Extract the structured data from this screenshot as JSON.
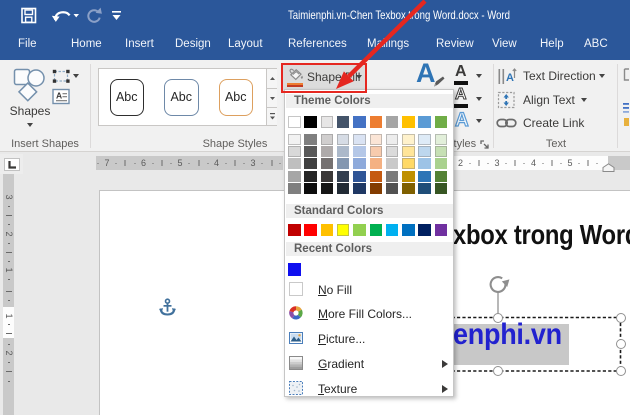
{
  "window": {
    "title": "Taimienphi.vn-Chen Texbox trong Word.docx  -  Word"
  },
  "tabs": [
    "File",
    "Home",
    "Insert",
    "Design",
    "Layout",
    "References",
    "Mailings",
    "Review",
    "View",
    "Help",
    "ABC"
  ],
  "ribbon": {
    "insert_shapes": {
      "label": "Insert Shapes",
      "shapes_button": "Shapes"
    },
    "shape_styles": {
      "label": "Shape Styles",
      "gallery_items": [
        "Abc",
        "Abc",
        "Abc"
      ],
      "gallery_outline_colors": [
        "#2E2E2E",
        "#6E89A8",
        "#DDA05F"
      ],
      "shape_fill_button": "Shape Fill"
    },
    "wordart": {
      "label": "WordArt Styles",
      "quick_styles_letter": "A",
      "text_fill_letter": "A",
      "text_outline_letter": "A",
      "text_effects_letter": "A"
    },
    "text_group": {
      "label": "Text",
      "text_direction": "Text Direction",
      "align_text": "Align Text",
      "create_link": "Create Link"
    }
  },
  "ruler": {
    "h_left_numbers": [
      "7",
      "6",
      "5",
      "4",
      "3"
    ],
    "h_right_numbers": [
      "2",
      "3",
      "4",
      "5"
    ],
    "v_numbers": [
      "3",
      "2",
      "1",
      "1",
      "2"
    ]
  },
  "document": {
    "heading_visible_text": "xbox trong Word",
    "textbox_visible_text": "enphi.vn",
    "textbox_text_color": "#2222CF",
    "selection_highlight_color": "#C8C8C8"
  },
  "menu": {
    "theme_section_label": "Theme Colors",
    "standard_section_label": "Standard Colors",
    "recent_section_label": "Recent Colors",
    "theme_colors": [
      "#FFFFFF",
      "#000000",
      "#E7E6E6",
      "#44546A",
      "#4472C4",
      "#ED7D31",
      "#A5A5A5",
      "#FFC000",
      "#5B9BD5",
      "#70AD47"
    ],
    "theme_tints": [
      [
        "#F2F2F2",
        "#D9D9D9",
        "#BFBFBF",
        "#A6A6A6",
        "#7F7F7F"
      ],
      [
        "#7F7F7F",
        "#595959",
        "#404040",
        "#262626",
        "#0D0D0D"
      ],
      [
        "#D0CECE",
        "#AEAAAA",
        "#757171",
        "#3B3838",
        "#161616"
      ],
      [
        "#D6DCE5",
        "#ACB9CA",
        "#8497B0",
        "#333F50",
        "#222B35"
      ],
      [
        "#DAE3F3",
        "#B4C7E7",
        "#8EAADB",
        "#2F5597",
        "#1F3864"
      ],
      [
        "#FBE5D6",
        "#F8CBAD",
        "#F4B183",
        "#C55A11",
        "#833C00"
      ],
      [
        "#EDEDED",
        "#DBDBDB",
        "#C9C9C9",
        "#7B7B7B",
        "#525252"
      ],
      [
        "#FFF2CC",
        "#FFE599",
        "#FFD966",
        "#BF9000",
        "#7F6000"
      ],
      [
        "#DEEBF7",
        "#BDD7EE",
        "#9DC3E6",
        "#2E75B6",
        "#1F4E79"
      ],
      [
        "#E2EFDA",
        "#C6E0B4",
        "#A9D18E",
        "#548235",
        "#375623"
      ]
    ],
    "standard_colors": [
      "#C00000",
      "#FF0000",
      "#FFC000",
      "#FFFF00",
      "#92D050",
      "#00B050",
      "#00B0F0",
      "#0070C0",
      "#002060",
      "#7030A0"
    ],
    "recent_colors": [
      "#0F0FEF"
    ],
    "items": [
      {
        "icon": "no-fill-icon",
        "label": "No Fill",
        "submenu": false
      },
      {
        "icon": "color-wheel-icon",
        "label": "More Fill Colors...",
        "submenu": false
      },
      {
        "icon": "picture-icon",
        "label": "Picture...",
        "submenu": false
      },
      {
        "icon": "gradient-icon",
        "label": "Gradient",
        "submenu": true
      },
      {
        "icon": "texture-icon",
        "label": "Texture",
        "submenu": true
      }
    ]
  },
  "annotations": {
    "highlight_color": "#E52720"
  }
}
